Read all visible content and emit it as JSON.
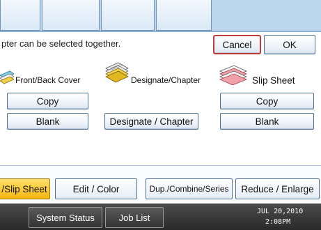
{
  "message": "pter can be selected together.",
  "buttons": {
    "cancel": "Cancel",
    "ok": "OK"
  },
  "categories": [
    {
      "label": "Front/Back Cover",
      "icon": "cover-icon",
      "row1": "Copy",
      "row2": "Blank"
    },
    {
      "label": "Designate/Chapter",
      "icon": "designate-chapter-icon",
      "row1": "",
      "row2": "Designate / Chapter"
    },
    {
      "label": "Slip Sheet",
      "icon": "slip-sheet-icon",
      "row1": "Copy",
      "row2": "Blank"
    }
  ],
  "tabs": [
    "/Slip Sheet",
    "Edit / Color",
    "Dup./Combine/Series",
    "Reduce / Enlarge"
  ],
  "status_bar": {
    "system_status": "System Status",
    "job_list": "Job List",
    "date": "JUL  20,2010",
    "time": "2:08PM"
  },
  "colors": {
    "accent_tab": "#f6b70e",
    "cancel_border": "#c33a3a",
    "frame_blue": "#4d6f93"
  }
}
